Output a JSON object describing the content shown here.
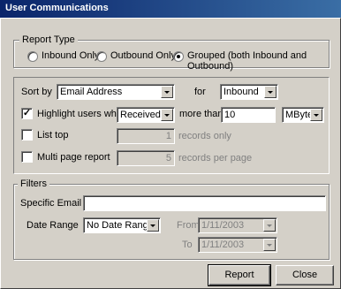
{
  "window": {
    "title": "User Communications"
  },
  "report_type": {
    "legend": "Report Type",
    "options": [
      {
        "label": "Inbound Only",
        "selected": false
      },
      {
        "label": "Outbound Only",
        "selected": false
      },
      {
        "label": "Grouped (both Inbound and Outbound)",
        "selected": true
      }
    ]
  },
  "sort": {
    "label": "Sort by",
    "value": "Email Address",
    "for_label": "for",
    "for_value": "Inbound"
  },
  "highlight": {
    "label": "Highlight users who",
    "checked": true,
    "action_value": "Received",
    "more_than_label": "more than",
    "amount": "10",
    "unit_value": "MBytes"
  },
  "list_top": {
    "label": "List top",
    "checked": false,
    "value": "1",
    "suffix": "records only"
  },
  "multi_page": {
    "label": "Multi page report",
    "checked": false,
    "value": "5",
    "suffix": "records per page"
  },
  "filters": {
    "legend": "Filters",
    "email_label": "Specific Email",
    "email_value": "",
    "date_range_label": "Date Range",
    "date_range_value": "No Date Range",
    "from_label": "From",
    "from_value": "1/11/2003",
    "to_label": "To",
    "to_value": "1/11/2003"
  },
  "buttons": {
    "report": "Report",
    "close": "Close"
  }
}
